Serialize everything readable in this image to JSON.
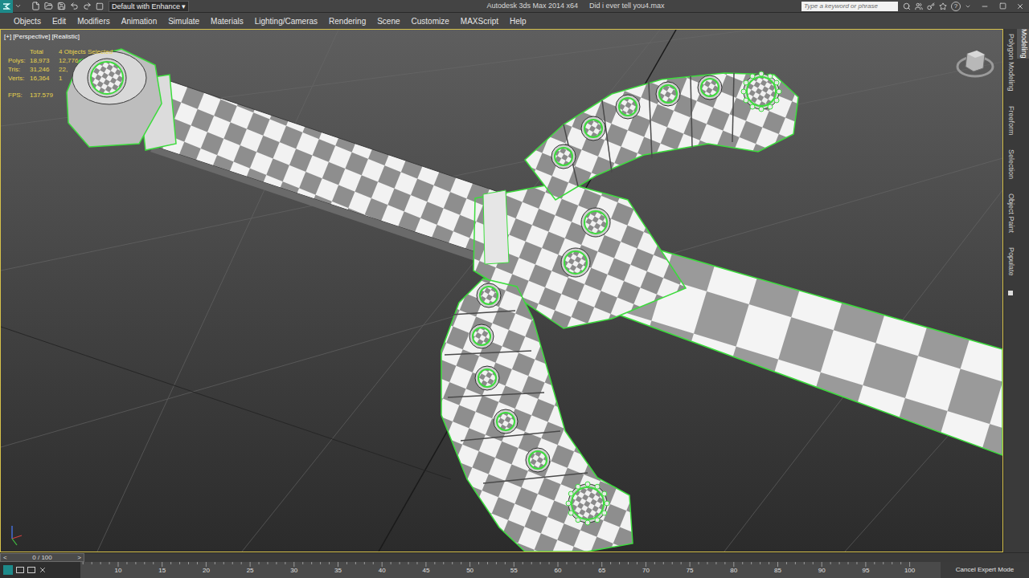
{
  "title_bar": {
    "workspace": "Default with Enhance",
    "workspace_arrow": "▾",
    "app": "Autodesk 3ds Max 2014 x64",
    "file": "Did i ever tell you4.max",
    "search_placeholder": "Type a keyword or phrase",
    "help": "?"
  },
  "menu": [
    "Objects",
    "Edit",
    "Modifiers",
    "Animation",
    "Simulate",
    "Materials",
    "Lighting/Cameras",
    "Rendering",
    "Scene",
    "Customize",
    "MAXScript",
    "Help"
  ],
  "viewport": {
    "labels": [
      "[+]",
      "[Perspective]",
      "[Realistic]"
    ],
    "active": true,
    "stats": {
      "header": [
        "Total",
        "4 Objects Selected"
      ],
      "rows": [
        {
          "label": "Polys:",
          "total": "18,973",
          "selected": "12,776"
        },
        {
          "label": "Tris:",
          "total": "31,246",
          "selected": "22,"
        },
        {
          "label": "Verts:",
          "total": "16,364",
          "selected": "1"
        }
      ],
      "fps_label": "FPS:",
      "fps": "137.579"
    }
  },
  "ribbon": {
    "tabs": [
      {
        "label": "Modeling",
        "selected": true
      }
    ],
    "panels": [
      "Polygon Modeling",
      "Freeform",
      "Selection",
      "Object Paint",
      "Populate"
    ]
  },
  "timeline": {
    "prev": "<",
    "position": "0 / 100",
    "next": ">",
    "level": 0
  },
  "track": {
    "ticks": [
      "10",
      "15",
      "20",
      "25",
      "30",
      "35",
      "40",
      "45",
      "50",
      "55",
      "60",
      "65",
      "70",
      "75",
      "80",
      "85",
      "90",
      "95",
      "100"
    ]
  },
  "status": {
    "button": "Cancel Expert Mode"
  }
}
